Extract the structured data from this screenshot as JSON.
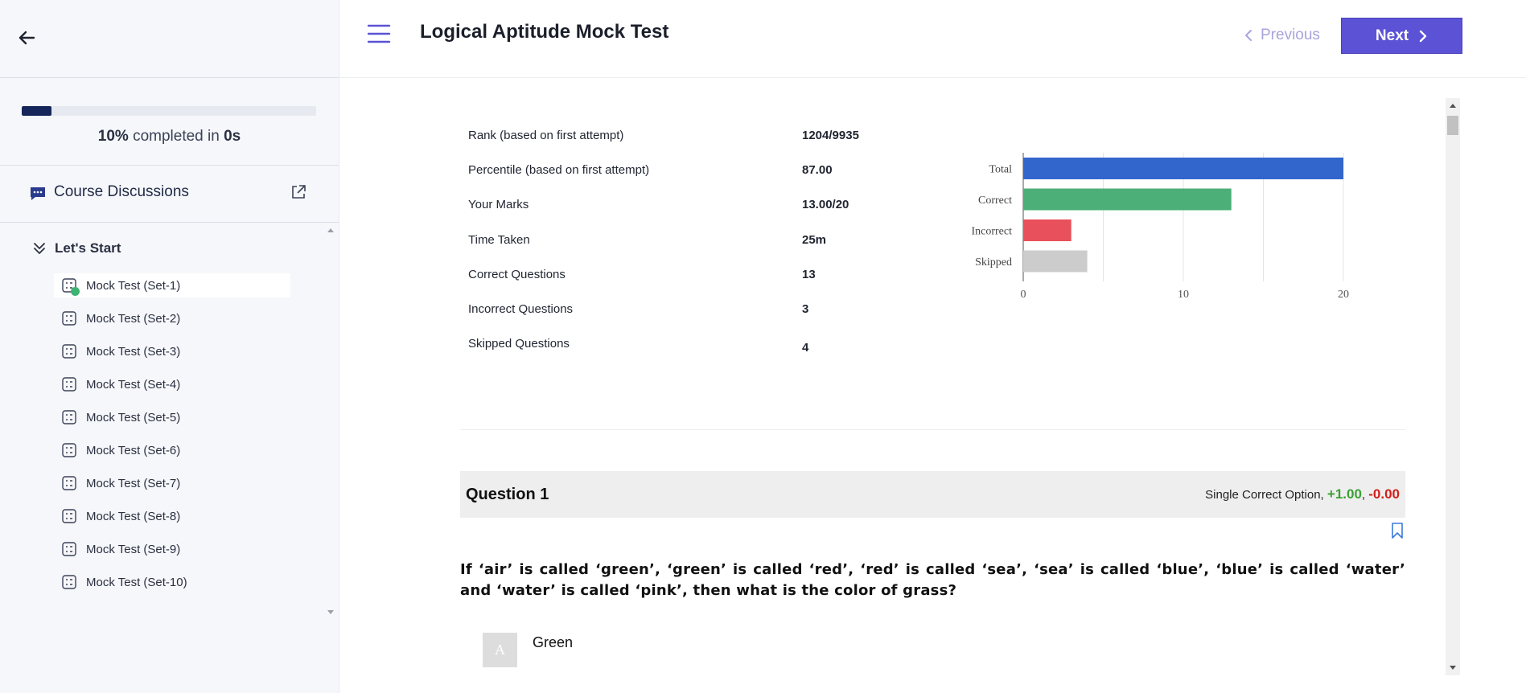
{
  "sidebar": {
    "progress": {
      "percent": 10,
      "percent_text": "10%",
      "completed_text": "completed in",
      "time_text": "0s"
    },
    "discussions": {
      "label": "Course Discussions"
    },
    "section": {
      "label": "Let's Start"
    },
    "items": [
      {
        "label": "Mock Test (Set-1)"
      },
      {
        "label": "Mock Test (Set-2)"
      },
      {
        "label": "Mock Test (Set-3)"
      },
      {
        "label": "Mock Test (Set-4)"
      },
      {
        "label": "Mock Test (Set-5)"
      },
      {
        "label": "Mock Test (Set-6)"
      },
      {
        "label": "Mock Test (Set-7)"
      },
      {
        "label": "Mock Test (Set-8)"
      },
      {
        "label": "Mock Test (Set-9)"
      },
      {
        "label": "Mock Test (Set-10)"
      }
    ]
  },
  "header": {
    "title": "Logical Aptitude Mock Test",
    "prev_label": "Previous",
    "next_label": "Next"
  },
  "stats": [
    {
      "label": "Rank (based on first attempt)",
      "value": "1204/9935"
    },
    {
      "label": "Percentile (based on first attempt)",
      "value": "87.00"
    },
    {
      "label": "Your Marks",
      "value": "13.00/20"
    },
    {
      "label": "Time Taken",
      "value": "25m"
    },
    {
      "label": "Correct Questions",
      "value": "13"
    },
    {
      "label": "Incorrect Questions",
      "value": "3"
    },
    {
      "label": "Skipped Questions",
      "value": "4"
    }
  ],
  "chart_data": {
    "type": "bar",
    "orientation": "horizontal",
    "categories": [
      "Total",
      "Correct",
      "Incorrect",
      "Skipped"
    ],
    "values": [
      20,
      13,
      3,
      4
    ],
    "colors": [
      "#3366cc",
      "#4caf78",
      "#e8505b",
      "#cccccc"
    ],
    "xlim": [
      0,
      20
    ],
    "xticks": [
      0,
      10,
      20
    ],
    "grid": true
  },
  "question": {
    "title": "Question 1",
    "type_label": "Single Correct Option,",
    "positive": "+1.00",
    "sep": ",",
    "negative": "-0.00",
    "text": "If ‘air’ is called ‘green’, ‘green’ is called ‘red’, ‘red’ is called ‘sea’, ‘sea’ is called ‘blue’, ‘blue’ is called ‘water’ and ‘water’ is called ‘pink’, then what is the color of grass?",
    "options": [
      {
        "letter": "A",
        "text": "Green"
      }
    ]
  },
  "colors": {
    "accent": "#5b52d6",
    "progress": "#17265a",
    "positive": "#3ba034",
    "negative": "#d0201a"
  }
}
